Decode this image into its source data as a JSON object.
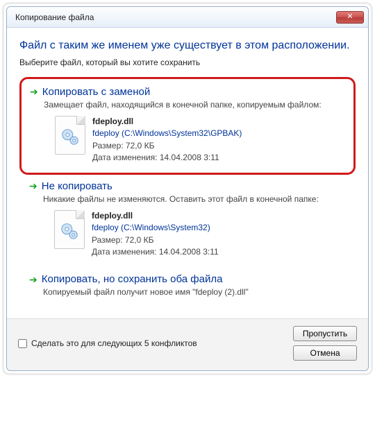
{
  "window": {
    "title": "Копирование файла"
  },
  "instruction": {
    "main": "Файл с таким же именем уже существует в этом расположении.",
    "sub": "Выберите файл, который вы хотите сохранить"
  },
  "options": {
    "replace": {
      "title": "Копировать с заменой",
      "desc": "Замещает файл, находящийся в конечной папке, копируемым файлом:",
      "file": {
        "name": "fdeploy.dll",
        "path": "fdeploy (C:\\Windows\\System32\\GPBAK)",
        "size": "Размер: 72,0 КБ",
        "date": "Дата изменения: 14.04.2008 3:11"
      }
    },
    "skip": {
      "title": "Не копировать",
      "desc": "Никакие файлы не изменяются. Оставить этот файл в конечной папке:",
      "file": {
        "name": "fdeploy.dll",
        "path": "fdeploy (C:\\Windows\\System32)",
        "size": "Размер: 72,0 КБ",
        "date": "Дата изменения: 14.04.2008 3:11"
      }
    },
    "both": {
      "title": "Копировать, но сохранить оба файла",
      "desc": "Копируемый файл получит новое имя \"fdeploy (2).dll\""
    }
  },
  "footer": {
    "checkbox_label": "Сделать это для следующих 5 конфликтов",
    "skip_button": "Пропустить",
    "cancel_button": "Отмена"
  }
}
